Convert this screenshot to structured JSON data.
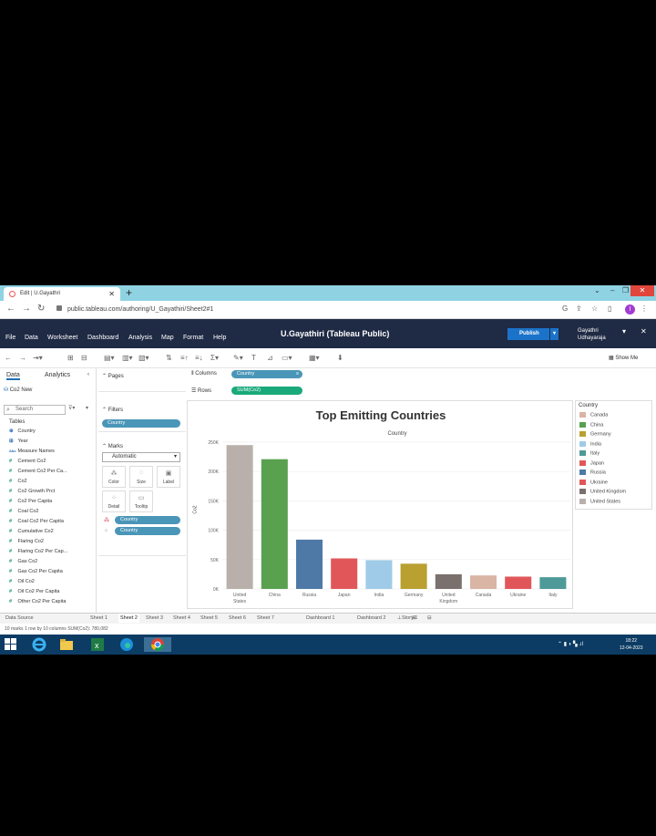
{
  "browser": {
    "tab_title": "Edit | U.Gayathri",
    "url": "public.tableau.com/authoring/U_Gayathiri/Sheet2#1",
    "profile_initial": "I"
  },
  "tableau": {
    "menu": [
      "File",
      "Data",
      "Worksheet",
      "Dashboard",
      "Analysis",
      "Map",
      "Format",
      "Help"
    ],
    "doc_title": "U.Gayathiri (Tableau Public)",
    "publish_label": "Publish",
    "user_line1": "Gayathri",
    "user_line2": "Udhayaraja",
    "show_me": "Show Me"
  },
  "data_pane": {
    "tab_data": "Data",
    "tab_analytics": "Analytics",
    "datasource": "Co2 New",
    "search_placeholder": "Search",
    "tables_label": "Tables",
    "fields": [
      {
        "icon": "globe",
        "name": "Country"
      },
      {
        "icon": "calendar",
        "name": "Year"
      },
      {
        "icon": "abc",
        "name": "Measure Names"
      },
      {
        "icon": "measure",
        "name": "Cement Co2"
      },
      {
        "icon": "measure",
        "name": "Cement Co2 Per Ca..."
      },
      {
        "icon": "measure",
        "name": "Co2"
      },
      {
        "icon": "measure",
        "name": "Co2 Growth Prct"
      },
      {
        "icon": "measure",
        "name": "Co2 Per Capita"
      },
      {
        "icon": "measure",
        "name": "Coal Co2"
      },
      {
        "icon": "measure",
        "name": "Coal Co2 Per Capita"
      },
      {
        "icon": "measure",
        "name": "Cumulative Co2"
      },
      {
        "icon": "measure",
        "name": "Flaring Co2"
      },
      {
        "icon": "measure",
        "name": "Flaring Co2 Per Cap..."
      },
      {
        "icon": "measure",
        "name": "Gas Co2"
      },
      {
        "icon": "measure",
        "name": "Gas Co2 Per Capita"
      },
      {
        "icon": "measure",
        "name": "Oil Co2"
      },
      {
        "icon": "measure",
        "name": "Oil Co2 Per Capita"
      },
      {
        "icon": "measure",
        "name": "Other Co2 Per Capita"
      }
    ]
  },
  "cards": {
    "pages": "Pages",
    "filters": "Filters",
    "filter_pill": "Country",
    "marks": "Marks",
    "mark_type": "Automatic",
    "mark_buttons": [
      "Color",
      "Size",
      "Label",
      "Detail",
      "Tooltip"
    ],
    "mark_pills": [
      "Country",
      "Country"
    ]
  },
  "shelves": {
    "columns_label": "Columns",
    "columns_pill": "Country",
    "rows_label": "Rows",
    "rows_pill": "SUM(Co2)"
  },
  "chart_data": {
    "type": "bar",
    "title": "Top Emitting Countries",
    "header": "Country",
    "ylabel": "Co2",
    "xlabel": "",
    "ylim": [
      0,
      250000
    ],
    "yticks": [
      0,
      50000,
      100000,
      150000,
      200000,
      250000
    ],
    "ytick_labels": [
      "0K",
      "50K",
      "100K",
      "150K",
      "200K",
      "250K"
    ],
    "categories": [
      "United States",
      "China",
      "Russia",
      "Japan",
      "India",
      "Germany",
      "United Kingdom",
      "Canada",
      "Ukraine",
      "Italy"
    ],
    "values": [
      245000,
      221000,
      84000,
      52000,
      49000,
      43000,
      25000,
      23000,
      21000,
      20000
    ],
    "colors": [
      "#b9b0ab",
      "#59a14f",
      "#4e79a7",
      "#e15759",
      "#a0cbe8",
      "#b9a030",
      "#7a716e",
      "#d8b5a5",
      "#e15759",
      "#4e9a98"
    ],
    "grid": true,
    "legend": "right"
  },
  "legend": {
    "title": "Country",
    "items": [
      {
        "name": "Canada",
        "color": "#d8b5a5"
      },
      {
        "name": "China",
        "color": "#59a14f"
      },
      {
        "name": "Germany",
        "color": "#b9a030"
      },
      {
        "name": "India",
        "color": "#a0cbe8"
      },
      {
        "name": "Italy",
        "color": "#4e9a98"
      },
      {
        "name": "Japan",
        "color": "#e15759"
      },
      {
        "name": "Russia",
        "color": "#4e79a7"
      },
      {
        "name": "Ukraine",
        "color": "#e15759"
      },
      {
        "name": "United Kingdom",
        "color": "#7a716e"
      },
      {
        "name": "United States",
        "color": "#b9b0ab"
      }
    ]
  },
  "sheet_tabs": [
    "Data Source",
    "Sheet 1",
    "Sheet 2",
    "Sheet 3",
    "Sheet 4",
    "Sheet 5",
    "Sheet 6",
    "Sheet 7",
    "Dashboard 1",
    "Dashboard 2",
    "Story 1"
  ],
  "active_sheet": "Sheet 2",
  "status": "10 marks   1 row by 10 columns   SUM(Co2): 780,082",
  "taskbar": {
    "time": "18:22",
    "date": "12-04-2023"
  }
}
